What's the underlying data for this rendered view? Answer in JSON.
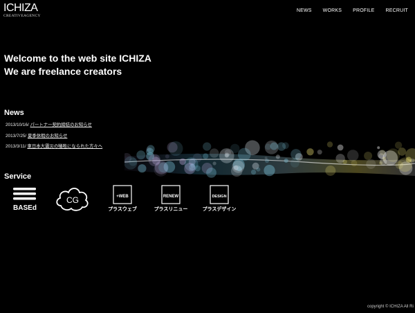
{
  "logo": {
    "main": "ICHIZA",
    "sub": "CREATIVEAGENCY"
  },
  "nav": [
    {
      "label": "NEWS"
    },
    {
      "label": "WORKS"
    },
    {
      "label": "PROFILE"
    },
    {
      "label": "RECRUIT"
    }
  ],
  "welcome": {
    "line1": "Welcome to the web site ICHIZA",
    "line2": "We are freelance creators"
  },
  "news": {
    "heading": "News",
    "items": [
      {
        "date": "2013/10/16/",
        "title": "パートナー契約締結のお知らせ"
      },
      {
        "date": "2013/7/25/",
        "title": "夏季休暇のお知らせ"
      },
      {
        "date": "2013/3/11/",
        "title": "東日本大震災の犠牲になられた方々へ"
      }
    ]
  },
  "service": {
    "heading": "Service",
    "items": [
      {
        "label": "BASEd",
        "icon": "based-icon"
      },
      {
        "label": "CG",
        "icon": "cloud-cg-icon"
      },
      {
        "label": "プラスウェブ",
        "badge": "+WEB",
        "icon": "plus-web-icon"
      },
      {
        "label": "プラスリニュー",
        "badge": "RENEW",
        "icon": "plus-renew-icon"
      },
      {
        "label": "プラスデザイン",
        "badge": "DESIGN",
        "icon": "plus-design-icon"
      }
    ]
  },
  "copyright": "copyright © ICHIZA All Ri"
}
